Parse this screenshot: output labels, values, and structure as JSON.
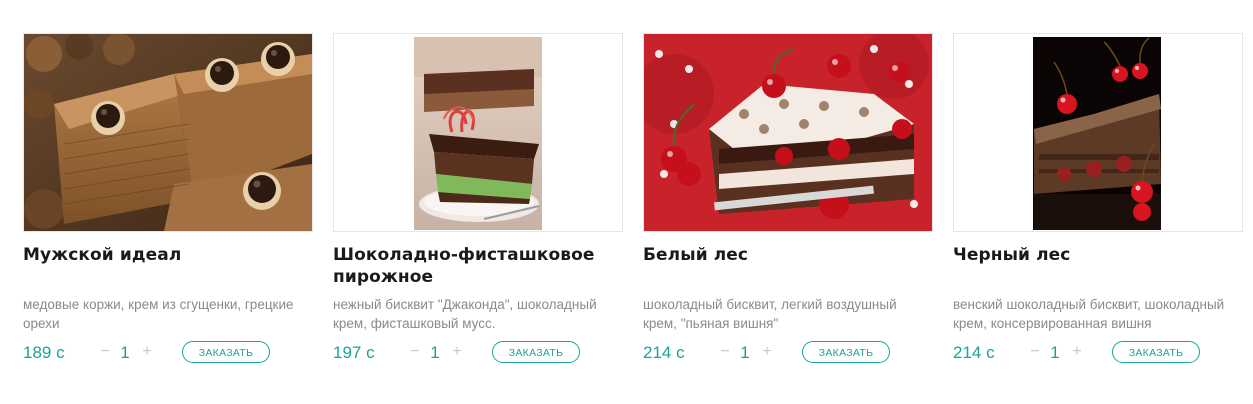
{
  "currency_suffix": "с",
  "order_label": "ЗАКАЗАТЬ",
  "qty_minus": "−",
  "qty_plus": "+",
  "products": [
    {
      "title": "Мужской идеал",
      "description": "медовые коржи, крем из сгущенки, грецкие орехи",
      "price": "189 с",
      "quantity": "1"
    },
    {
      "title": "Шоколадно-фисташковое пирожное",
      "description": "нежный бисквит \"Джаконда\", шоколадный крем, фисташковый мусс.",
      "price": "197 с",
      "quantity": "1"
    },
    {
      "title": "Белый лес",
      "description": "шоколадный бисквит, легкий воздушный крем, \"пьяная вишня\"",
      "price": "214 с",
      "quantity": "1"
    },
    {
      "title": "Черный лес",
      "description": "венский шоколадный бисквит, шоколадный крем, консервированная вишня",
      "price": "214 с",
      "quantity": "1"
    }
  ],
  "colors": {
    "accent": "#1aa39a",
    "title": "#1a1a1a",
    "description": "#8a8a8a",
    "border": "#e6e6e6"
  }
}
